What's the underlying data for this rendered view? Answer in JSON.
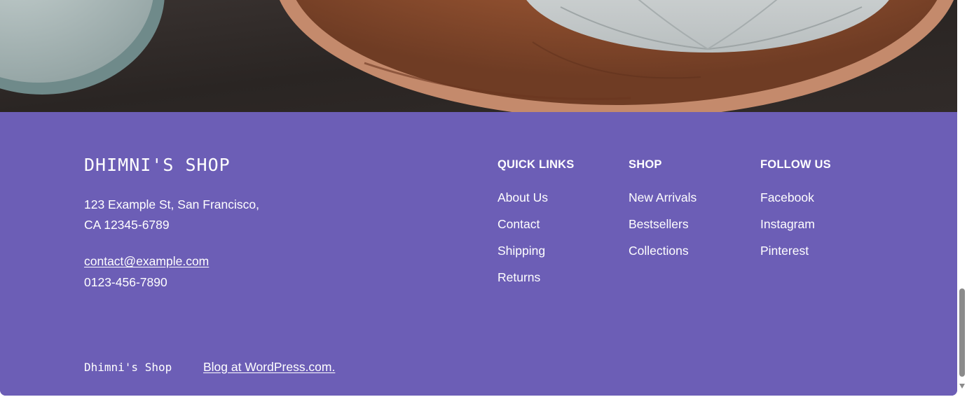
{
  "hero": {
    "image": "pottery-bowls-on-wooden-plate-photo"
  },
  "footer": {
    "brand": "DHIMNI'S SHOP",
    "address_line1": "123 Example St, San Francisco,",
    "address_line2": "CA 12345-6789",
    "email": "contact@example.com",
    "phone": "0123-456-7890",
    "columns": [
      {
        "heading": "QUICK LINKS",
        "links": [
          "About Us",
          "Contact",
          "Shipping",
          "Returns"
        ]
      },
      {
        "heading": "SHOP",
        "links": [
          "New Arrivals",
          "Bestsellers",
          "Collections"
        ]
      },
      {
        "heading": "FOLLOW US",
        "links": [
          "Facebook",
          "Instagram",
          "Pinterest"
        ]
      }
    ],
    "bottom_brand": "Dhimni's Shop",
    "bottom_link": "Blog at WordPress.com."
  },
  "colors": {
    "footer_bg": "#6c5eb6",
    "text": "#ffffff",
    "scroll_thumb": "#8b8b8b"
  }
}
